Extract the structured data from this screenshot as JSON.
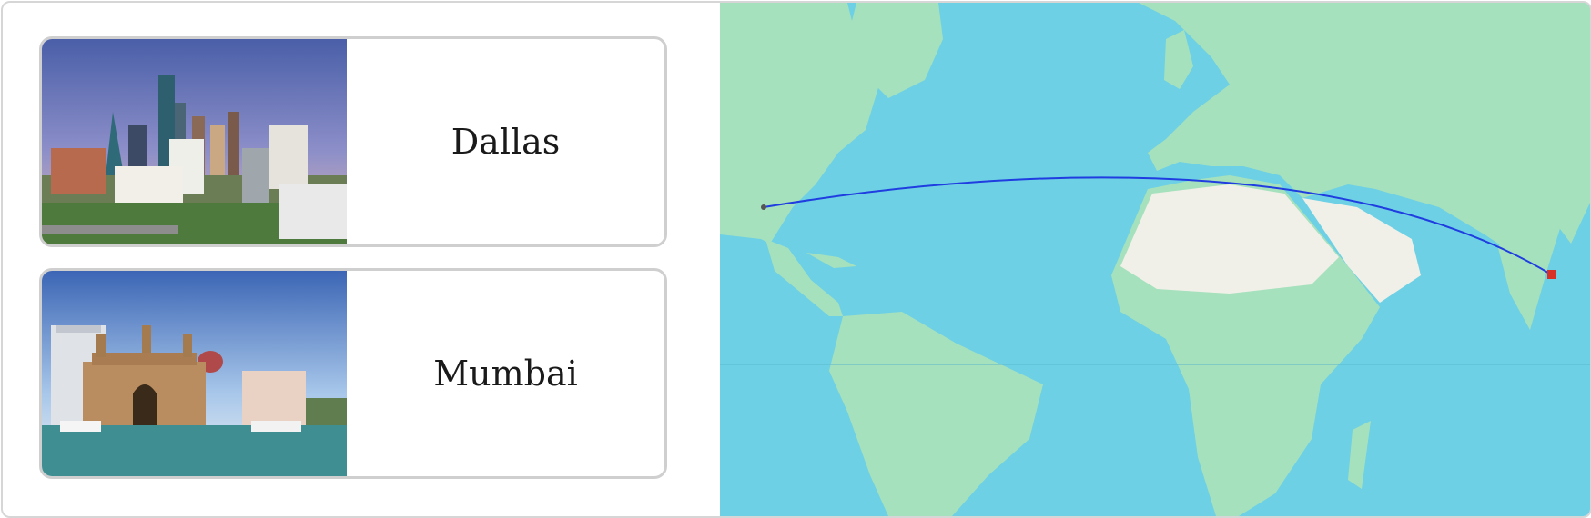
{
  "route": {
    "origin": {
      "city": "Dallas"
    },
    "destination": {
      "city": "Mumbai"
    },
    "line_color": "#1f3de0"
  },
  "map": {
    "ocean_color": "#6dd0e4",
    "land_color": "#a6e1bd",
    "desert_color": "#f1f0e8"
  }
}
